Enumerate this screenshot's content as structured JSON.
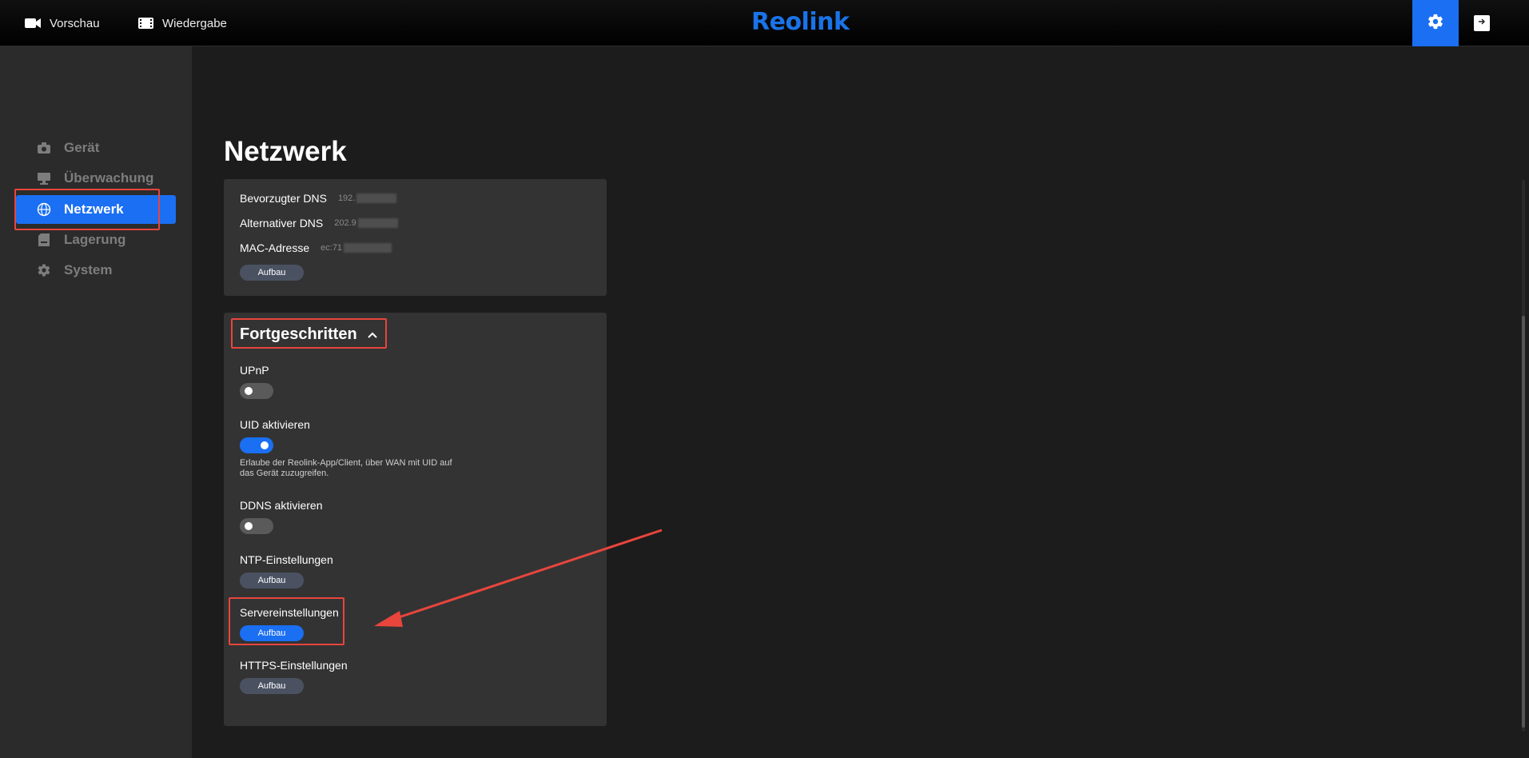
{
  "topbar": {
    "preview_label": "Vorschau",
    "playback_label": "Wiedergabe",
    "logo_text": "Reolink"
  },
  "sidebar": {
    "items": [
      {
        "label": "Gerät",
        "icon": "camera-icon"
      },
      {
        "label": "Überwachung",
        "icon": "monitor-icon"
      },
      {
        "label": "Netzwerk",
        "icon": "globe-icon",
        "active": true
      },
      {
        "label": "Lagerung",
        "icon": "storage-icon"
      },
      {
        "label": "System",
        "icon": "gear-icon"
      }
    ]
  },
  "main": {
    "title": "Netzwerk",
    "network_card": {
      "rows": [
        {
          "label": "Bevorzugter DNS",
          "value": "192."
        },
        {
          "label": "Alternativer DNS",
          "value": "202.9"
        },
        {
          "label": "MAC-Adresse",
          "value": "ec:71"
        }
      ],
      "setup_button": "Aufbau"
    },
    "advanced": {
      "title": "Fortgeschritten",
      "upnp": {
        "label": "UPnP",
        "enabled": false
      },
      "uid": {
        "label": "UID aktivieren",
        "enabled": true,
        "hint": "Erlaube der Reolink-App/Client, über WAN mit UID auf das Gerät zuzugreifen."
      },
      "ddns": {
        "label": "DDNS aktivieren",
        "enabled": false
      },
      "ntp": {
        "label": "NTP-Einstellungen",
        "button": "Aufbau"
      },
      "server": {
        "label": "Servereinstellungen",
        "button": "Aufbau"
      },
      "https": {
        "label": "HTTPS-Einstellungen",
        "button": "Aufbau"
      }
    }
  },
  "colors": {
    "accent": "#1a6ff2",
    "annotation": "#e8453c"
  }
}
